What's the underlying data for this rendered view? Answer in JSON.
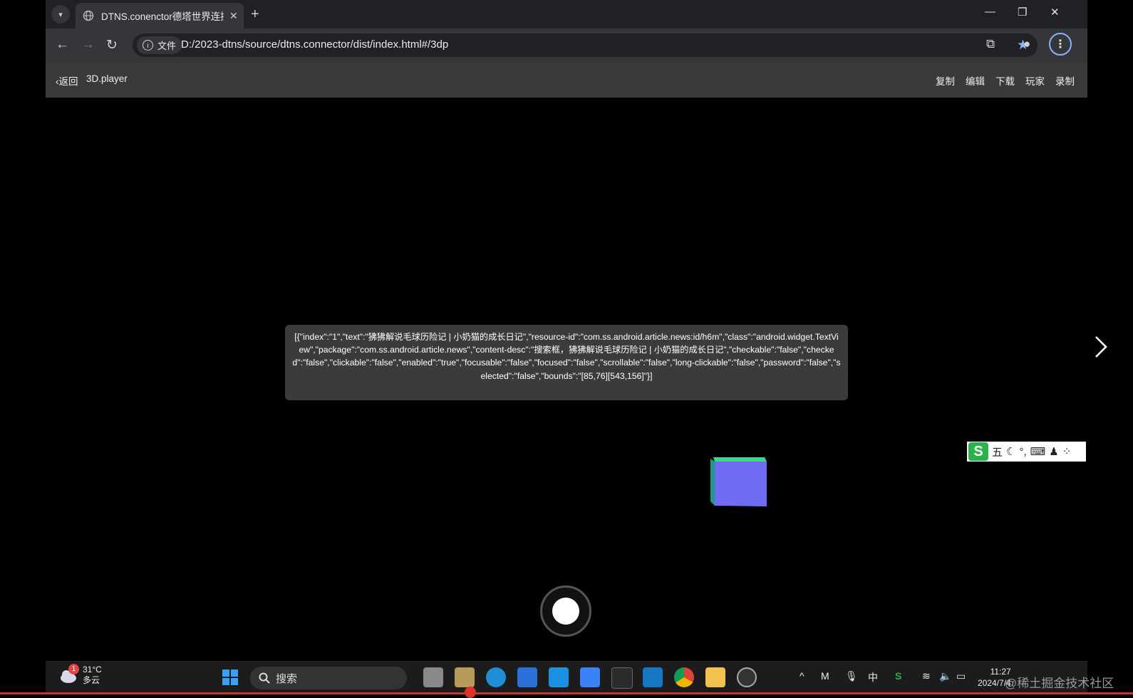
{
  "browser": {
    "tab_title": "DTNS.conenctor德塔世界连接",
    "origin_chip": "文件",
    "url": "D:/2023-dtns/source/dtns.connector/dist/index.html#/3dp"
  },
  "app": {
    "back_label": "返回",
    "title": "3D.player",
    "actions": [
      "复制",
      "编辑",
      "下载",
      "玩家",
      "录制"
    ]
  },
  "content": {
    "info_text": "[{\"index\":\"1\",\"text\":\"狒狒解说毛球历险记 | 小奶猫的成长日记\",\"resource-id\":\"com.ss.android.article.news:id/h6m\",\"class\":\"android.widget.TextView\",\"package\":\"com.ss.android.article.news\",\"content-desc\":\"搜索框，狒狒解说毛球历险记 | 小奶猫的成长日记\",\"checkable\":\"false\",\"checked\":\"false\",\"clickable\":\"false\",\"enabled\":\"true\",\"focusable\":\"false\",\"focused\":\"false\",\"scrollable\":\"false\",\"long-clickable\":\"false\",\"password\":\"false\",\"selected\":\"false\",\"bounds\":\"[85,76][543,156]\"}]"
  },
  "ime": {
    "mode_label": "五"
  },
  "taskbar": {
    "weather_temp": "31°C",
    "weather_desc": "多云",
    "weather_badge": "1",
    "search_placeholder": "搜索",
    "ime_lang": "中",
    "time": "11:27",
    "date": "2024/7/4"
  },
  "watermark": "@稀土掘金技术社区",
  "colors": {
    "cube_front": "#6f6cf2",
    "cube_top": "#3fd68a",
    "cube_side": "#1f9a8a",
    "accent": "#8ab4f8"
  }
}
